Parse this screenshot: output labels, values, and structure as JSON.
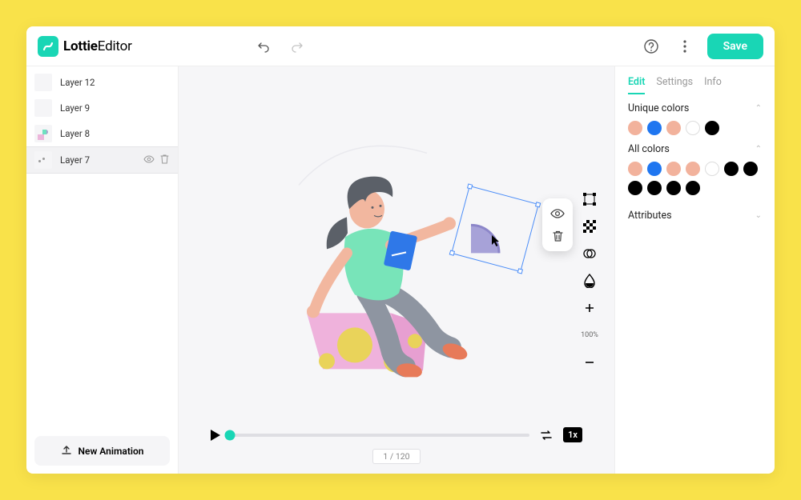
{
  "app": {
    "brand_bold": "Lottie",
    "brand_light": "Editor"
  },
  "toolbar": {
    "save_label": "Save"
  },
  "layers": {
    "items": [
      {
        "label": "Layer 12"
      },
      {
        "label": "Layer 9"
      },
      {
        "label": "Layer 8"
      },
      {
        "label": "Layer 7"
      }
    ],
    "new_animation_label": "New Animation"
  },
  "timeline": {
    "speed_label": "1x",
    "frame_label": "1 / 120"
  },
  "right": {
    "tabs": {
      "edit": "Edit",
      "settings": "Settings",
      "info": "Info"
    },
    "unique_colors_label": "Unique colors",
    "all_colors_label": "All colors",
    "attributes_label": "Attributes",
    "unique_colors": [
      "#f2b29c",
      "#1f76f0",
      "#f2b29c",
      "hollow",
      "#000000"
    ],
    "all_colors": [
      "#f2b29c",
      "#1f76f0",
      "#f2b29c",
      "#f2b29c",
      "hollow",
      "#000000",
      "#000000",
      "#000000",
      "#000000",
      "#000000",
      "#000000"
    ]
  },
  "zoom": {
    "percent": "100%"
  }
}
